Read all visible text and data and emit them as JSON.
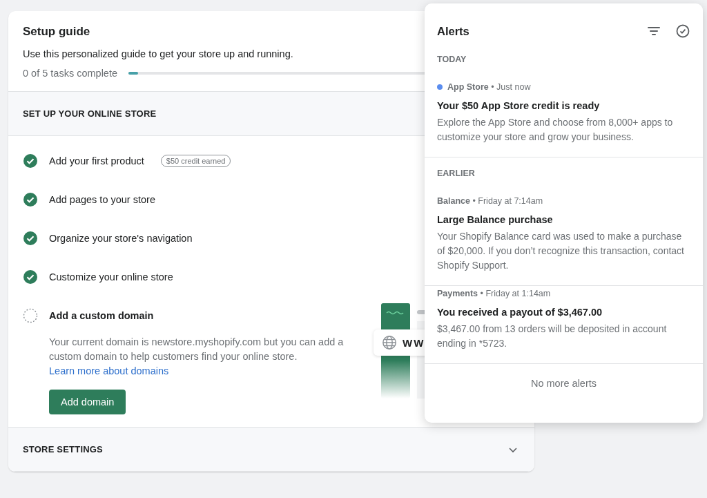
{
  "setup_guide": {
    "title": "Setup guide",
    "subtitle": "Use this personalized guide to get your store up and running.",
    "progress_label": "0 of 5 tasks complete",
    "level": 0.02,
    "sections": [
      {
        "label": "SET UP YOUR ONLINE STORE",
        "expanded": true,
        "tasks": [
          {
            "title": "Add your first product",
            "completed": true,
            "expanded": false,
            "badge": "$50 credit earned"
          },
          {
            "title": "Add pages to your store",
            "completed": true,
            "expanded": false
          },
          {
            "title": "Organize your store's navigation",
            "completed": true,
            "expanded": false
          },
          {
            "title": "Customize your online store",
            "completed": true,
            "expanded": false
          },
          {
            "title": "Add a custom domain",
            "completed": false,
            "expanded": true,
            "description": "Your current domain is newstore.myshopify.com but you can add a custom domain to help customers find your online store.",
            "link": "Learn more about domains",
            "button": "Add domain",
            "illustration_text": "WW"
          }
        ]
      },
      {
        "label": "STORE SETTINGS",
        "expanded": false
      }
    ]
  },
  "alerts": {
    "title": "Alerts",
    "meta_separator": "•",
    "groups": [
      {
        "label": "TODAY",
        "items": [
          {
            "source": "App Store",
            "time": "Just now",
            "unread": true,
            "title": "Your $50 App Store credit is ready",
            "body": "Explore the App Store and choose from 8,000+ apps to customize your store and grow your business."
          }
        ]
      },
      {
        "label": "EARLIER",
        "items": [
          {
            "source": "Balance",
            "time": "Friday at 7:14am",
            "unread": false,
            "title": "Large Balance purchase",
            "body": "Your Shopify Balance card was used to make a purchase of $20,000. If you don’t recognize this transaction, contact Shopify Support."
          },
          {
            "source": "Payments",
            "time": "Friday at 1:14am",
            "unread": false,
            "title": "You received a payout of $3,467.00",
            "body": "$3,467.00 from 13 orders will be deposited in account ending in *5723."
          }
        ]
      }
    ],
    "footer": "No more alerts"
  }
}
